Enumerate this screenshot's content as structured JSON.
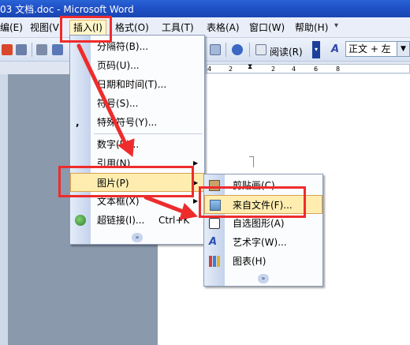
{
  "window": {
    "title": "03 文档.doc - Microsoft Word"
  },
  "menubar": {
    "items": [
      {
        "label": "编(E)",
        "name": "menu-edit"
      },
      {
        "label": "视图(V)",
        "name": "menu-view"
      },
      {
        "label": "插入(I)",
        "name": "menu-insert"
      },
      {
        "label": "格式(O)",
        "name": "menu-format"
      },
      {
        "label": "工具(T)",
        "name": "menu-tools"
      },
      {
        "label": "表格(A)",
        "name": "menu-table"
      },
      {
        "label": "窗口(W)",
        "name": "menu-window"
      },
      {
        "label": "帮助(H)",
        "name": "menu-help"
      }
    ]
  },
  "toolbar": {
    "read_label": "阅读(R)",
    "style_value": "正文 + 左"
  },
  "ruler": {
    "ticks": [
      "4",
      "2",
      "2",
      "4",
      "6",
      "8"
    ]
  },
  "insert_menu": {
    "items": [
      {
        "label": "分隔符(B)...",
        "name": "insert-break"
      },
      {
        "label": "页码(U)...",
        "name": "insert-page-numbers"
      },
      {
        "label": "日期和时间(T)...",
        "name": "insert-date-time"
      },
      {
        "label": "符号(S)...",
        "name": "insert-symbol"
      },
      {
        "label": "特殊符号(Y)...",
        "name": "insert-special-symbol"
      },
      {
        "label": "数字(R)...",
        "name": "insert-number"
      },
      {
        "label": "引用(N)",
        "name": "insert-reference"
      },
      {
        "label": "图片(P)",
        "name": "insert-picture"
      },
      {
        "label": "文本框(X)",
        "name": "insert-textbox"
      },
      {
        "label": "超链接(I)...",
        "name": "insert-hyperlink"
      }
    ],
    "hyperlink_shortcut": "Ctrl+K"
  },
  "picture_submenu": {
    "items": [
      {
        "label": "剪贴画(C)...",
        "name": "picture-clipart"
      },
      {
        "label": "来自文件(F)...",
        "name": "picture-from-file"
      },
      {
        "label": "自选图形(A)",
        "name": "picture-autoshapes"
      },
      {
        "label": "艺术字(W)...",
        "name": "picture-wordart"
      },
      {
        "label": "图表(H)",
        "name": "picture-chart"
      }
    ]
  },
  "colors": {
    "annotation_red": "#ee2c2c",
    "highlight": "#ffedb0"
  }
}
